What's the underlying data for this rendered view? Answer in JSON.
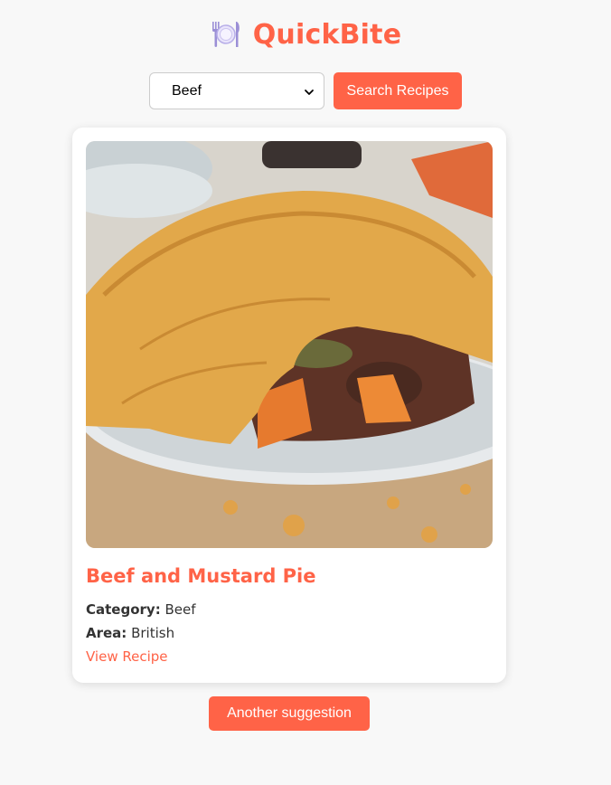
{
  "header": {
    "title": "QuickBite",
    "icon": "plate-cutlery-icon"
  },
  "search": {
    "selected_category": "Beef",
    "button_label": "Search Recipes"
  },
  "recipe": {
    "title": "Beef and Mustard Pie",
    "category_label": "Category:",
    "category_value": "Beef",
    "area_label": "Area:",
    "area_value": "British",
    "link_label": "View Recipe"
  },
  "footer": {
    "another_label": "Another suggestion"
  },
  "colors": {
    "accent": "#ff6347",
    "background": "#f8f8f8",
    "card": "#ffffff",
    "text": "#333333"
  }
}
